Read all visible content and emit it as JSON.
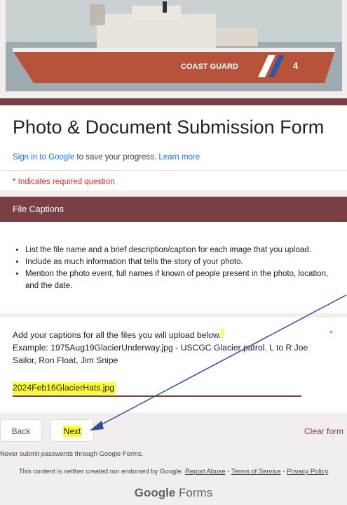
{
  "banner": {
    "hull_text": "COAST  GUARD",
    "hull_number": "4"
  },
  "form": {
    "title": "Photo & Document Submission Form",
    "signin_link": "Sign in to Google",
    "signin_rest": " to save your progress. ",
    "learn_more": "Learn more",
    "required_note": "* Indicates required question"
  },
  "section": {
    "title": "File Captions",
    "bullets": [
      "List the file name and a brief description/caption for each image that you upload.",
      "Include as much information that tells the story of your photo.",
      "Mention the photo event, full names if known of people present in the photo, location, and the date."
    ]
  },
  "question": {
    "text": "Add your captions for all the files you will upload below.",
    "example": "Example: 1975Aug19GlacierUnderway.jpg - USCGC Glacier patrol. L to R Joe Sailor, Ron Float, Jim Snipe",
    "required_mark": "*",
    "answer_value": "2024Feb16GlacierHats.jpg"
  },
  "nav": {
    "back": "Back",
    "next": "Next",
    "clear": "Clear form"
  },
  "footer": {
    "warning": "Never submit passwords through Google Forms.",
    "disclaimer": "This content is neither created nor endorsed by Google. ",
    "report": "Report Abuse",
    "sep1": " - ",
    "terms": "Terms of Service",
    "sep2": " - ",
    "privacy": "Privacy Policy",
    "brand_google": "Google",
    "brand_forms": " Forms"
  },
  "colors": {
    "accent": "#7a3f43",
    "highlight": "#ffff33",
    "arrow": "#2a4d9c"
  }
}
